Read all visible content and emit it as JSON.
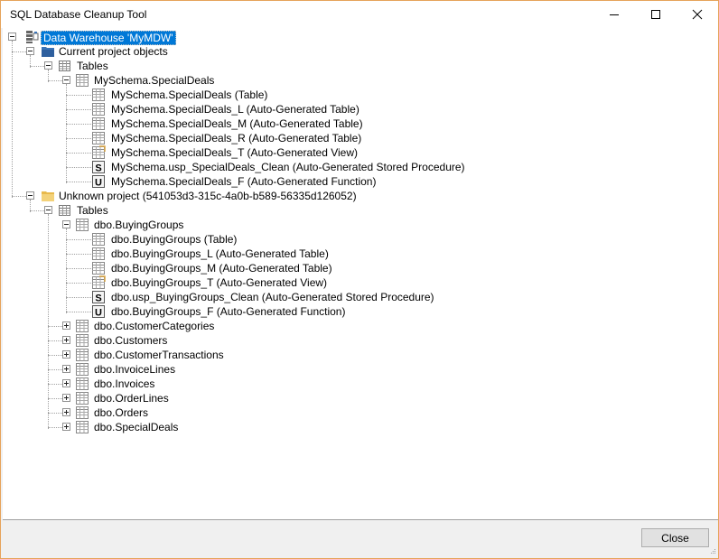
{
  "window": {
    "title": "SQL Database Cleanup Tool"
  },
  "tree": {
    "root": {
      "label": "Data Warehouse 'MyMDW'"
    },
    "current": {
      "label": "Current project objects",
      "tables_label": "Tables",
      "group_label": "MySchema.SpecialDeals",
      "items": [
        {
          "label": "MySchema.SpecialDeals (Table)",
          "icon": "table-icon"
        },
        {
          "label": "MySchema.SpecialDeals_L (Auto-Generated Table)",
          "icon": "table-icon"
        },
        {
          "label": "MySchema.SpecialDeals_M (Auto-Generated Table)",
          "icon": "table-icon"
        },
        {
          "label": "MySchema.SpecialDeals_R (Auto-Generated Table)",
          "icon": "table-icon"
        },
        {
          "label": "MySchema.SpecialDeals_T (Auto-Generated View)",
          "icon": "view-icon"
        },
        {
          "label": "MySchema.usp_SpecialDeals_Clean (Auto-Generated Stored Procedure)",
          "icon": "stored-procedure-icon",
          "glyph": "S"
        },
        {
          "label": "MySchema.SpecialDeals_F (Auto-Generated Function)",
          "icon": "function-icon",
          "glyph": "U"
        }
      ]
    },
    "unknown": {
      "label": "Unknown project (541053d3-315c-4a0b-b589-56335d126052)",
      "tables_label": "Tables",
      "group_label": "dbo.BuyingGroups",
      "items": [
        {
          "label": "dbo.BuyingGroups (Table)",
          "icon": "table-icon"
        },
        {
          "label": "dbo.BuyingGroups_L (Auto-Generated Table)",
          "icon": "table-icon"
        },
        {
          "label": "dbo.BuyingGroups_M (Auto-Generated Table)",
          "icon": "table-icon"
        },
        {
          "label": "dbo.BuyingGroups_T (Auto-Generated View)",
          "icon": "view-icon"
        },
        {
          "label": "dbo.usp_BuyingGroups_Clean (Auto-Generated Stored Procedure)",
          "icon": "stored-procedure-icon",
          "glyph": "S"
        },
        {
          "label": "dbo.BuyingGroups_F (Auto-Generated Function)",
          "icon": "function-icon",
          "glyph": "U"
        }
      ],
      "collapsed": [
        "dbo.CustomerCategories",
        "dbo.Customers",
        "dbo.CustomerTransactions",
        "dbo.InvoiceLines",
        "dbo.Invoices",
        "dbo.OrderLines",
        "dbo.Orders",
        "dbo.SpecialDeals"
      ]
    }
  },
  "footer": {
    "close_label": "Close"
  },
  "colors": {
    "selection": "#0078d7",
    "window_border": "#e6a35a",
    "folder_blue": "#3b74b7",
    "folder_yellow": "#f3d27a"
  }
}
